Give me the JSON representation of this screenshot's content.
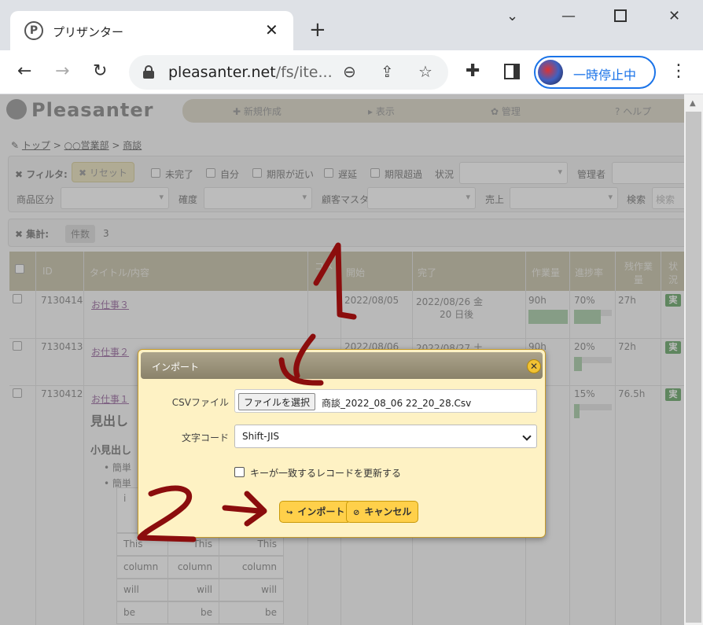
{
  "browser": {
    "tab_title": "プリザンター",
    "favicon_letter": "P",
    "url_host": "pleasanter.net",
    "url_rest": "/fs/ite...",
    "profile_label": "一時停止中"
  },
  "app": {
    "logo": "Pleasanter",
    "menu": [
      "新規作成",
      "表示",
      "管理",
      "ヘルプ"
    ],
    "breadcrumb": [
      "トップ",
      "○○営業部",
      "商談"
    ],
    "filters": {
      "label": "フィルタ:",
      "reset": "リセット",
      "checks": [
        "未完了",
        "自分",
        "期限が近い",
        "遅延",
        "期限超過"
      ],
      "status_label": "状況",
      "manager_label": "管理者",
      "product_label": "商品区分",
      "certainty_label": "確度",
      "customer_label": "顧客マスタ",
      "sales_label": "売上",
      "search_label": "検索",
      "search_placeholder": "検索"
    },
    "aggregation": {
      "label": "集計:",
      "chip": "件数",
      "value": "3"
    },
    "grid": {
      "headers": [
        "ID",
        "タイトル/内容",
        "コメ",
        "開始",
        "完了",
        "作業量",
        "進捗率",
        "残作業量",
        "状況"
      ],
      "rows": [
        {
          "id": "7130414",
          "title": "お仕事３",
          "start": "2022/08/05",
          "end": "2022/08/26 金",
          "remaining_days": "20 日後",
          "work": "90h",
          "progress": "70%",
          "progress_value": 0.7,
          "rest": "27h",
          "state": "実"
        },
        {
          "id": "7130413",
          "title": "お仕事２",
          "start": "2022/08/06",
          "end": "2022/08/27 土",
          "remaining_days": "",
          "work": "90h",
          "progress": "20%",
          "progress_value": 0.2,
          "rest": "72h",
          "state": "実"
        },
        {
          "id": "7130412",
          "title": "お仕事１",
          "start": "",
          "end": "",
          "remaining_days": "",
          "work": "",
          "progress": "15%",
          "progress_value": 0.15,
          "rest": "76.5h",
          "state": "実"
        }
      ],
      "body_heading1": "見出し",
      "body_heading2": "小見出し",
      "bullets": [
        "簡単",
        "簡単"
      ],
      "mini_table": [
        [
          "i",
          "",
          ""
        ],
        [
          "This",
          "This",
          "This"
        ],
        [
          "column",
          "column",
          "column"
        ],
        [
          "will",
          "will",
          "will"
        ],
        [
          "be",
          "be",
          "be"
        ]
      ]
    }
  },
  "dialog": {
    "title": "インポート",
    "csv_label": "CSVファイル",
    "file_button": "ファイルを選択",
    "file_name": "商談_2022_08_06 22_20_28.Csv",
    "encoding_label": "文字コード",
    "encoding_value": "Shift-JIS",
    "update_label": "キーが一致するレコードを更新する",
    "import_button": "インポート",
    "cancel_button": "キャンセル"
  },
  "colors": {
    "annotation": "#8b0d0d",
    "dialog_bg": "#fef2c4",
    "button_bg": "#ffd04a",
    "accent": "#1a73e8"
  }
}
